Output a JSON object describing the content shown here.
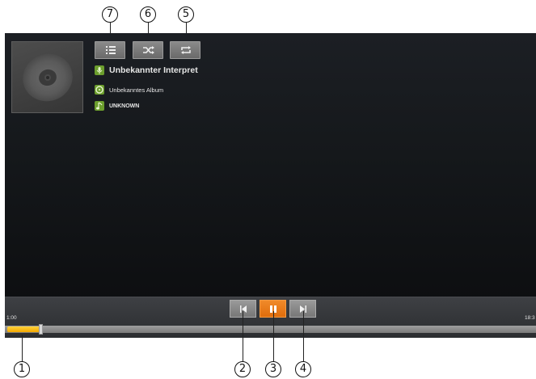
{
  "callouts": {
    "c1": "1",
    "c2": "2",
    "c3": "3",
    "c4": "4",
    "c5": "5",
    "c6": "6",
    "c7": "7"
  },
  "toolbar": {
    "buttons": [
      {
        "name": "playlist-button",
        "icon": "list-icon"
      },
      {
        "name": "shuffle-button",
        "icon": "shuffle-icon"
      },
      {
        "name": "repeat-button",
        "icon": "repeat-icon"
      }
    ]
  },
  "track_info": {
    "artist": "Unbekannter Interpret",
    "album": "Unbekanntes Album",
    "genre": "UNKNOWN",
    "artist_icon": "microphone-icon",
    "album_icon": "album-icon",
    "genre_icon": "music-note-icon"
  },
  "player": {
    "elapsed": "1:00",
    "total": "18:3",
    "progress": 0.062,
    "controls": [
      {
        "name": "previous-button",
        "icon": "previous-icon"
      },
      {
        "name": "pause-button",
        "icon": "pause-icon"
      },
      {
        "name": "next-button",
        "icon": "next-icon"
      }
    ]
  },
  "colors": {
    "accent": "#e8781a",
    "progress_fill": "#f7b500",
    "info_icon": "#6c9e2d"
  }
}
